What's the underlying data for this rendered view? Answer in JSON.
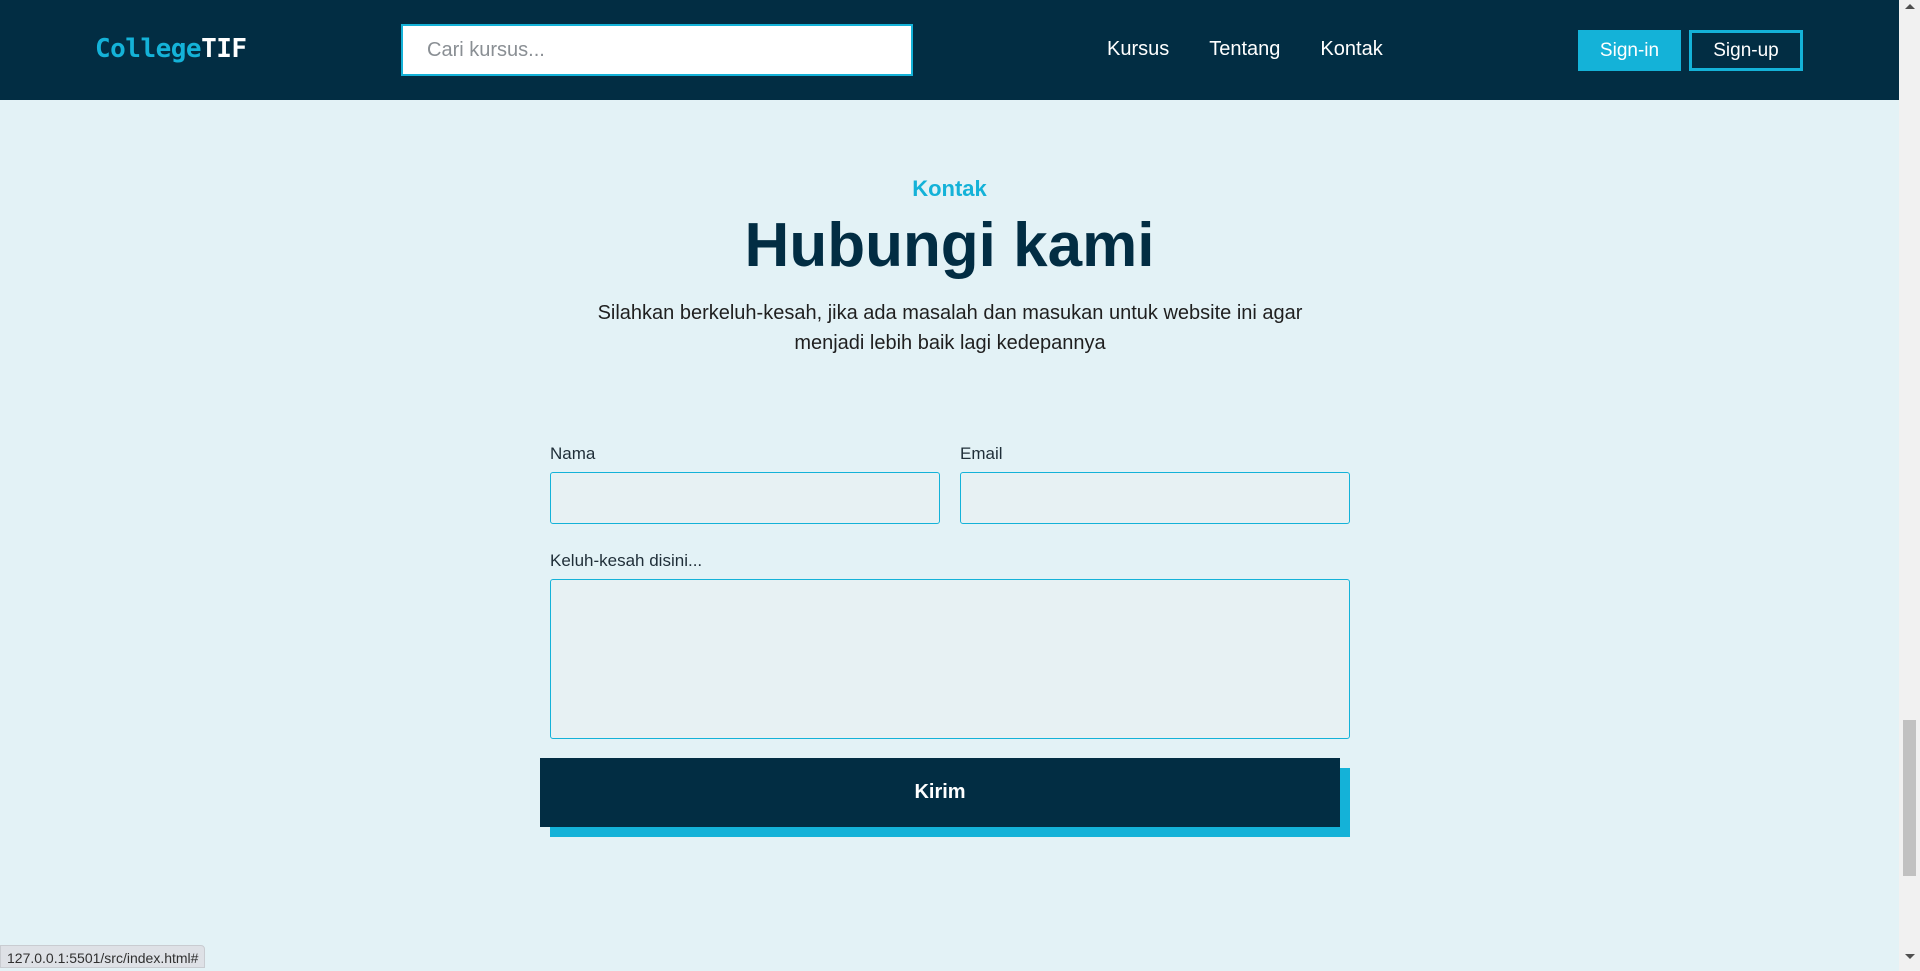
{
  "header": {
    "logo_part1": "College",
    "logo_part2": "TIF",
    "search_placeholder": "Cari kursus...",
    "nav": [
      "Kursus",
      "Tentang",
      "Kontak"
    ],
    "signin_label": "Sign-in",
    "signup_label": "Sign-up"
  },
  "contact": {
    "eyebrow": "Kontak",
    "title": "Hubungi kami",
    "subtitle": "Silahkan berkeluh-kesah, jika ada masalah dan masukan untuk website ini agar menjadi lebih baik lagi kedepannya",
    "name_label": "Nama",
    "email_label": "Email",
    "message_label": "Keluh-kesah disini...",
    "submit_label": "Kirim"
  },
  "status_bar": {
    "url": "127.0.0.1:5501/src/index.html#"
  },
  "colors": {
    "navy": "#022d43",
    "accent": "#14b2d8",
    "page_bg": "#e3f2f6"
  }
}
